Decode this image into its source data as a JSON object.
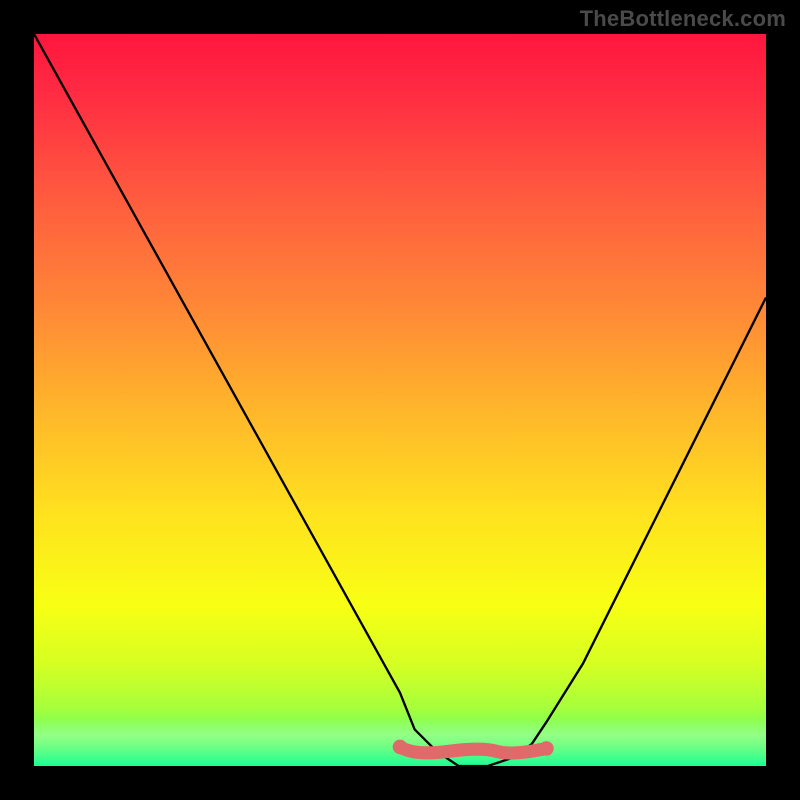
{
  "watermark": {
    "text": "TheBottleneck.com"
  },
  "chart_data": {
    "type": "line",
    "title": "",
    "xlabel": "",
    "ylabel": "",
    "xlim": [
      0,
      100
    ],
    "ylim": [
      0,
      100
    ],
    "note": "Y axis inverted in render: lower value = lower on screen. Values are bottleneck percentage; 0 = optimal.",
    "series": [
      {
        "name": "bottleneck-curve",
        "x": [
          0,
          5,
          10,
          15,
          20,
          25,
          30,
          35,
          40,
          45,
          50,
          52,
          55,
          58,
          62,
          65,
          68,
          70,
          75,
          80,
          85,
          90,
          95,
          100
        ],
        "y": [
          100,
          91,
          82,
          73,
          64,
          55,
          46,
          37,
          28,
          19,
          10,
          5,
          2,
          0,
          0,
          1,
          3,
          6,
          14,
          24,
          34,
          44,
          54,
          64
        ]
      }
    ],
    "flat_segment": {
      "name": "optimal-range-marker",
      "color": "#e06a6a",
      "x_start": 50,
      "x_end": 70,
      "y": 2
    },
    "gradient_stops": [
      {
        "pct": 0,
        "color": "#ff163e"
      },
      {
        "pct": 50,
        "color": "#ffe31e"
      },
      {
        "pct": 100,
        "color": "#19ff96"
      }
    ]
  }
}
